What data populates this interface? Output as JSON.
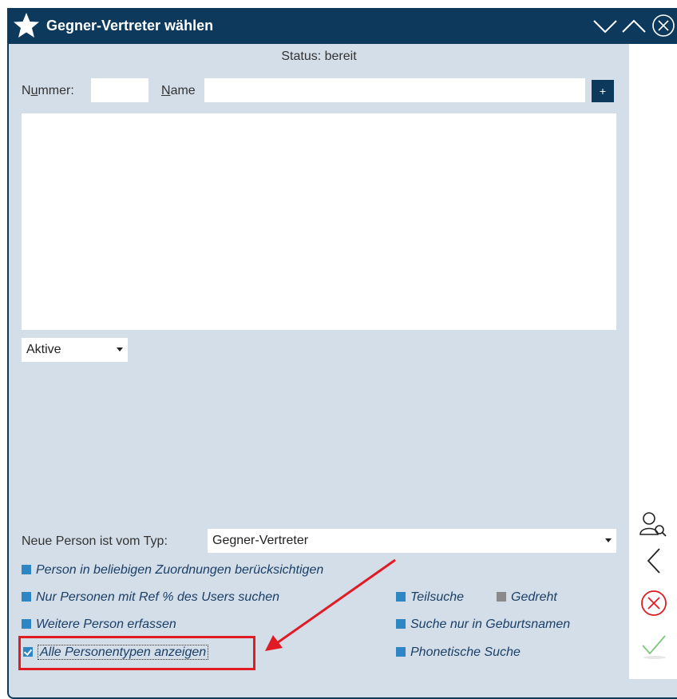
{
  "window": {
    "title": "Gegner-Vertreter wählen"
  },
  "status": {
    "text": "Status: bereit"
  },
  "search": {
    "nummer_label_pre": "N",
    "nummer_label_ul": "u",
    "nummer_label_post": "mmer:",
    "nummer_value": "",
    "name_label_ul": "N",
    "name_label_post": "ame",
    "name_value": "",
    "plus_label": "+"
  },
  "filter": {
    "selected": "Aktive"
  },
  "new_person": {
    "label": "Neue Person ist vom Typ:",
    "selected": "Gegner-Vertreter"
  },
  "options": {
    "zuordnungen": "Person in beliebigen Zuordnungen berücksichtigen",
    "ref_users": "Nur Personen mit Ref % des Users suchen",
    "weitere": "Weitere Person erfassen",
    "alle_typen": "Alle Personentypen  anzeigen",
    "teilsuche": "Teilsuche",
    "gedreht": "Gedreht",
    "geburtsnamen": "Suche nur in Geburtsnamen",
    "phonetisch": "Phonetische Suche"
  },
  "colors": {
    "titlebar": "#0d3a5c",
    "background": "#d3dee9",
    "accent": "#2f86c4",
    "annotation": "#e01b24"
  }
}
